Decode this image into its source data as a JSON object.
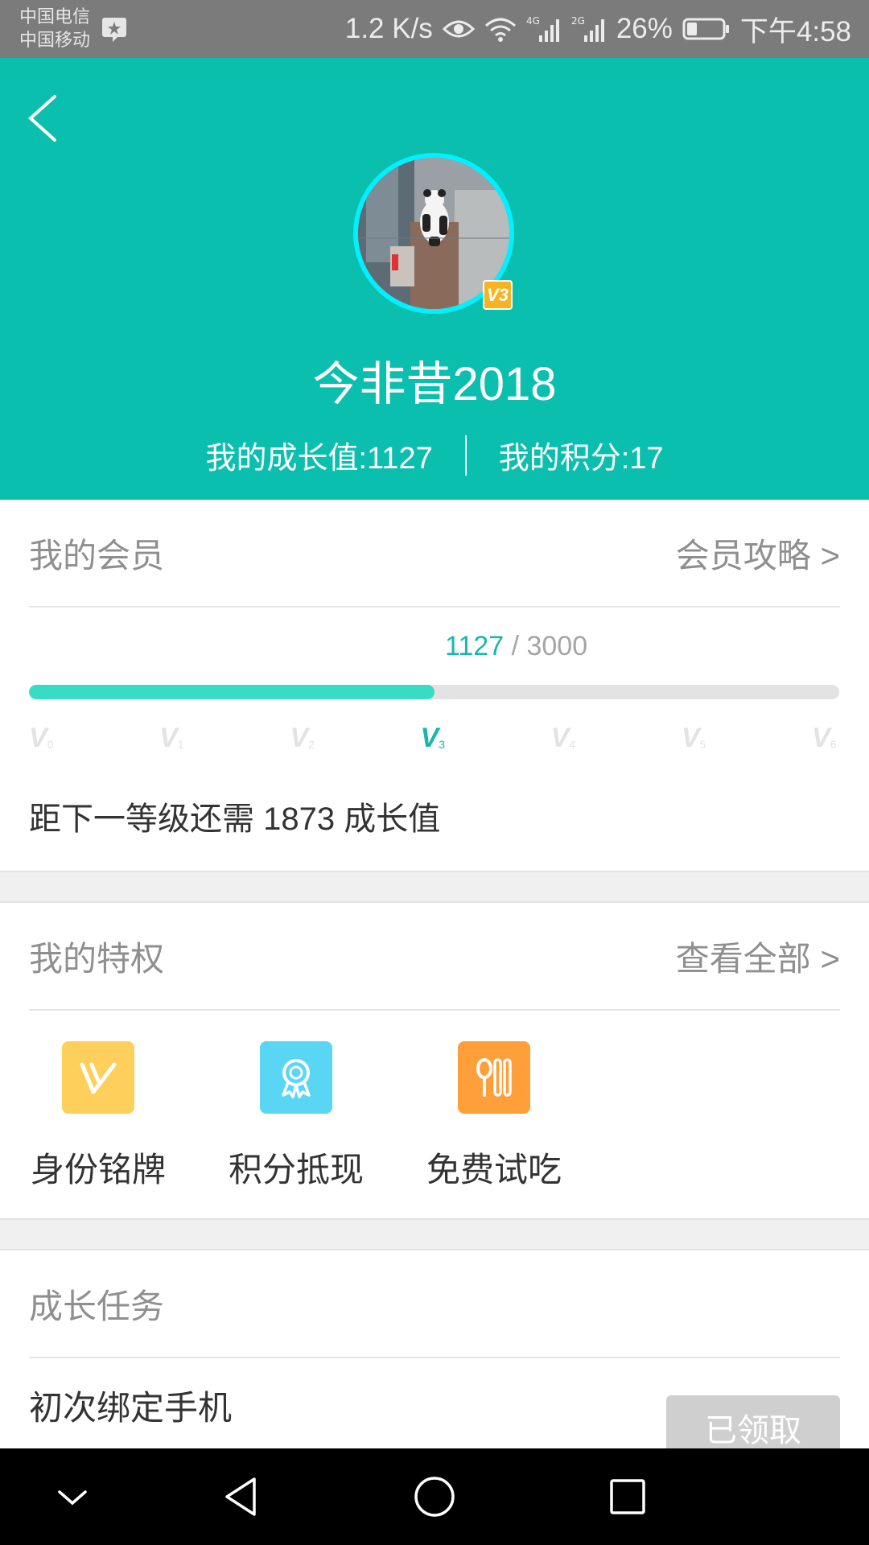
{
  "status_bar": {
    "carrier_1": "中国电信",
    "carrier_2": "中国移动",
    "speed": "1.2 K/s",
    "net_1": "4G",
    "net_2": "2G",
    "battery": "26%",
    "time": "下午4:58"
  },
  "header": {
    "nickname": "今非昔2018",
    "level_badge": "V3",
    "growth_label": "我的成长值:1127",
    "points_label": "我的积分:17",
    "bg_color": "#0abfae"
  },
  "membership": {
    "title": "我的会员",
    "guide_link": "会员攻略 >",
    "current": "1127",
    "target": "/ 3000",
    "progress_fraction": 0.5,
    "levels": [
      {
        "name": "V",
        "sub": "0"
      },
      {
        "name": "V",
        "sub": "1"
      },
      {
        "name": "V",
        "sub": "2"
      },
      {
        "name": "V",
        "sub": "3"
      },
      {
        "name": "V",
        "sub": "4"
      },
      {
        "name": "V",
        "sub": "5"
      },
      {
        "name": "V",
        "sub": "6"
      }
    ],
    "active_level_index": 3,
    "next_level_text": "距下一等级还需 1873 成长值"
  },
  "privileges": {
    "title": "我的特权",
    "view_all": "查看全部 >",
    "items": [
      {
        "label": "身份铭牌",
        "icon": "v-badge-icon",
        "color": "#ffcf5c"
      },
      {
        "label": "积分抵现",
        "icon": "award-ribbon-icon",
        "color": "#5ad6f5"
      },
      {
        "label": "免费试吃",
        "icon": "spoon-fork-icon",
        "color": "#ff9f3a"
      }
    ]
  },
  "tasks": {
    "title": "成长任务",
    "items": [
      {
        "name": "初次绑定手机",
        "button": "已领取"
      }
    ]
  }
}
